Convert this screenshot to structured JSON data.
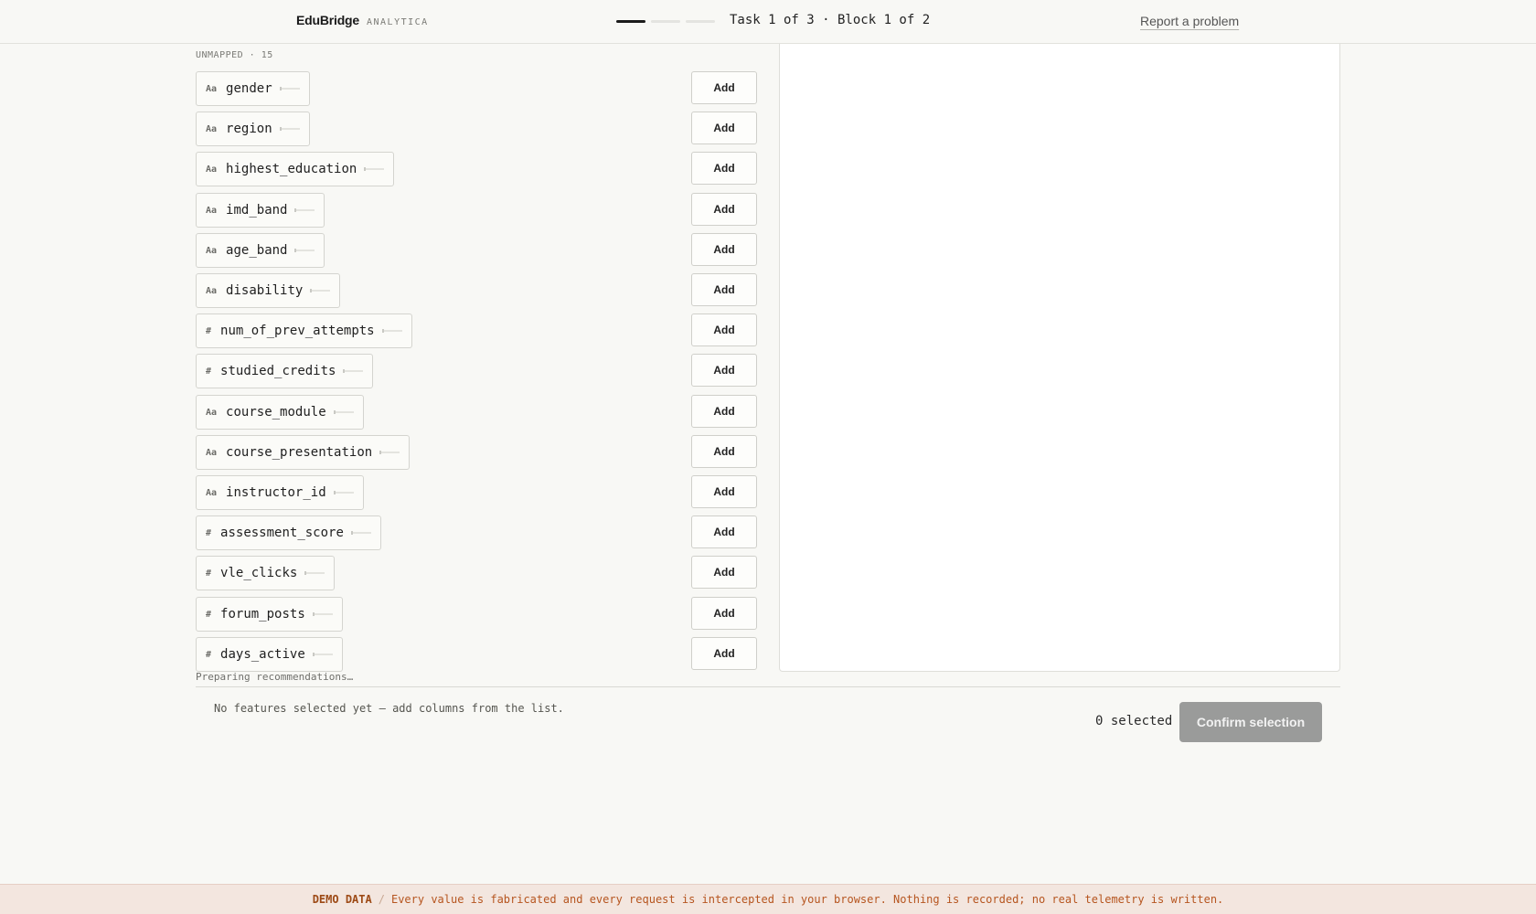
{
  "header": {
    "brand": "EduBridge",
    "brand_sub": "ANALYTICA",
    "progress": {
      "total_steps": 3,
      "current_step": 1
    },
    "task_label": "Task 1 of 3 · Block 1 of 2",
    "report_label": "Report a problem"
  },
  "features": {
    "section_label": "UNMAPPED · 15",
    "add_label": "Add",
    "items": [
      {
        "icon": "Aa",
        "type": "text",
        "name": "gender"
      },
      {
        "icon": "Aa",
        "type": "text",
        "name": "region"
      },
      {
        "icon": "Aa",
        "type": "text",
        "name": "highest_education"
      },
      {
        "icon": "Aa",
        "type": "text",
        "name": "imd_band"
      },
      {
        "icon": "Aa",
        "type": "text",
        "name": "age_band"
      },
      {
        "icon": "Aa",
        "type": "text",
        "name": "disability"
      },
      {
        "icon": "#",
        "type": "numeric",
        "name": "num_of_prev_attempts"
      },
      {
        "icon": "#",
        "type": "numeric",
        "name": "studied_credits"
      },
      {
        "icon": "Aa",
        "type": "text",
        "name": "course_module"
      },
      {
        "icon": "Aa",
        "type": "text",
        "name": "course_presentation"
      },
      {
        "icon": "Aa",
        "type": "text",
        "name": "instructor_id"
      },
      {
        "icon": "#",
        "type": "numeric",
        "name": "assessment_score"
      },
      {
        "icon": "#",
        "type": "numeric",
        "name": "vle_clicks"
      },
      {
        "icon": "#",
        "type": "numeric",
        "name": "forum_posts"
      },
      {
        "icon": "#",
        "type": "numeric",
        "name": "days_active"
      }
    ],
    "preparing_text": "Preparing recommendations…"
  },
  "footer": {
    "empty_note": "No features selected yet — add columns from the list.",
    "selected_count": "0 selected",
    "confirm_label": "Confirm selection"
  },
  "demo_banner": {
    "tag": "DEMO DATA",
    "separator": "/",
    "message": "Every value is fabricated and every request is intercepted in your browser. Nothing is recorded; no real telemetry is written."
  },
  "colors": {
    "background": "#f8f8f5",
    "confirm_disabled": "#9a9b9a",
    "banner_bg": "#f3e6df",
    "banner_text": "#b6551f"
  }
}
